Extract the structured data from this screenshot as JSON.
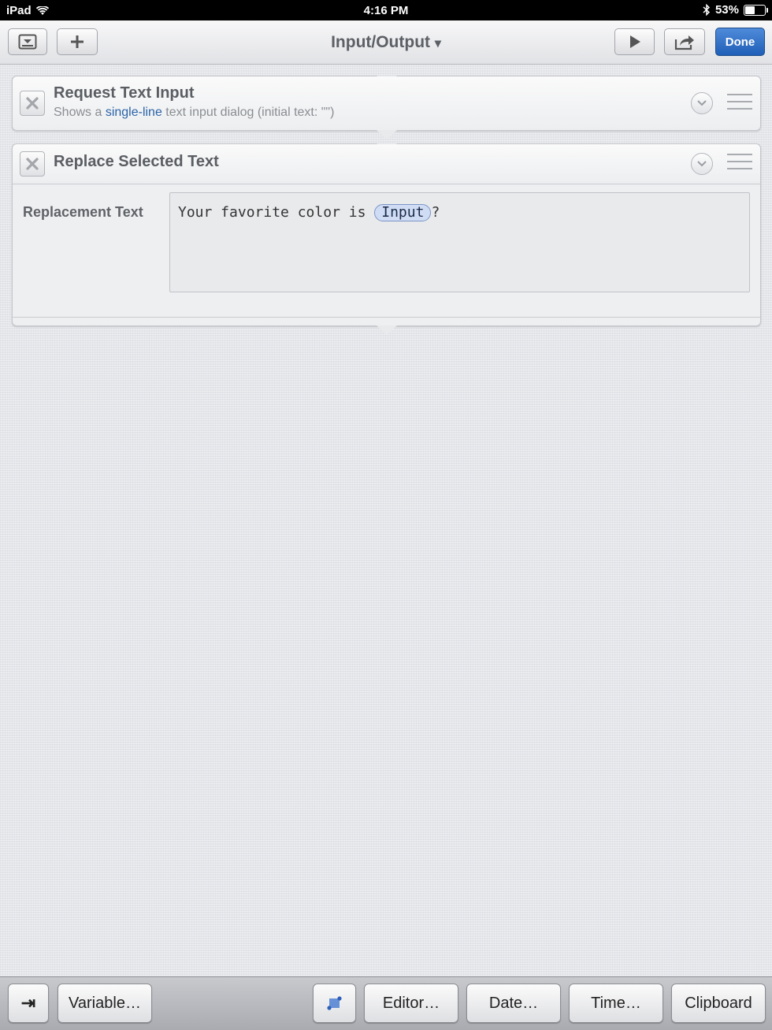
{
  "status_bar": {
    "device": "iPad",
    "time": "4:16 PM",
    "battery": "53%",
    "battery_level": 0.53
  },
  "nav": {
    "title": "Input/Output",
    "title_caret": "▾",
    "done_label": "Done"
  },
  "actions": [
    {
      "title": "Request Text Input",
      "subtitle_prefix": "Shows a ",
      "subtitle_link": "single-line",
      "subtitle_suffix": " text input dialog (initial text: \"\")"
    },
    {
      "title": "Replace Selected Text",
      "param_label": "Replacement Text",
      "param_text_before": "Your favorite color is ",
      "param_token": "Input",
      "param_text_after": "?"
    }
  ],
  "bottom_bar": {
    "tab_glyph": "⇥",
    "variable_label": "Variable…",
    "editor_label": "Editor…",
    "date_label": "Date…",
    "time_label": "Time…",
    "clipboard_label": "Clipboard"
  },
  "colors": {
    "accent": "#1f5fb8",
    "link": "#2b63a8",
    "token_bg": "#cfdcf4"
  }
}
